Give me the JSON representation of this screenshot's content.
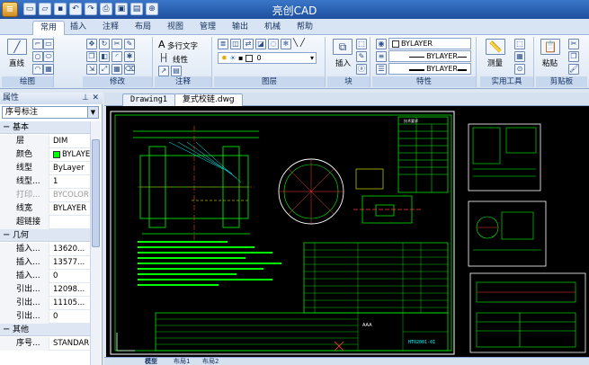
{
  "title_bar": {
    "app_title": "亮创CAD"
  },
  "quick_access": {
    "app_menu_glyph": "≡",
    "buttons": [
      {
        "name": "new-icon",
        "glyph": "▭"
      },
      {
        "name": "open-icon",
        "glyph": "▱"
      },
      {
        "name": "save-icon",
        "glyph": "▪"
      },
      {
        "name": "undo-icon",
        "glyph": "↶"
      },
      {
        "name": "redo-icon",
        "glyph": "↷"
      },
      {
        "name": "print-icon",
        "glyph": "⎙"
      },
      {
        "name": "preview-icon",
        "glyph": "▣"
      },
      {
        "name": "plot-icon",
        "glyph": "▤"
      },
      {
        "name": "zoom-icon",
        "glyph": "⊕"
      }
    ]
  },
  "ribbon": {
    "tabs": [
      "常用",
      "插入",
      "注释",
      "布局",
      "视图",
      "管理",
      "输出",
      "机械",
      "帮助"
    ],
    "active_tab": "常用",
    "panels": {
      "draw": {
        "label": "绘图",
        "line_label": "直线"
      },
      "modify": {
        "label": "修改"
      },
      "annotation": {
        "label": "注释",
        "text_label": "多行文字",
        "dim_label": "线性"
      },
      "layers": {
        "label": "图层",
        "layer_value": "0"
      },
      "block": {
        "label": "块",
        "insert_label": "插入"
      },
      "properties": {
        "label": "特性",
        "color_value": "BYLAYER",
        "linetype_value": "BYLAYER",
        "lineweight_value": "BYLAYER"
      },
      "utilities": {
        "label": "实用工具",
        "measure_label": "测量"
      },
      "clipboard": {
        "label": "剪贴板",
        "paste_label": "粘贴"
      }
    }
  },
  "properties_palette": {
    "title": "属性",
    "selection": "序号标注",
    "sections": [
      {
        "title": "基本",
        "rows": [
          {
            "key": "层",
            "value": "DIM"
          },
          {
            "key": "颜色",
            "value": "BYLAYER",
            "color": "#00ff00"
          },
          {
            "key": "线型",
            "value": "ByLayer"
          },
          {
            "key": "线型...",
            "value": "1"
          },
          {
            "key": "打印...",
            "value": "BYCOLOR",
            "dim": true
          },
          {
            "key": "线宽",
            "value": "BYLAYER"
          },
          {
            "key": "超链接",
            "value": ""
          }
        ]
      },
      {
        "title": "几何",
        "rows": [
          {
            "key": "插入...",
            "value": "13620..."
          },
          {
            "key": "插入...",
            "value": "13577..."
          },
          {
            "key": "插入...",
            "value": "0"
          },
          {
            "key": "引出...",
            "value": "12098..."
          },
          {
            "key": "引出...",
            "value": "11105..."
          },
          {
            "key": "引出...",
            "value": "0"
          }
        ]
      },
      {
        "title": "其他",
        "rows": [
          {
            "key": "序号...",
            "value": "STANDARD"
          }
        ]
      }
    ]
  },
  "document_tabs": [
    {
      "label": "Drawing1",
      "active": false
    },
    {
      "label": "复式校链.dwg",
      "active": true
    }
  ],
  "layout_tabs": [
    "模型",
    "布局1",
    "布局2"
  ],
  "drawing": {
    "sheet_title": "技术要求",
    "drawing_code": "HT02001-01",
    "company_stamp": "AAA",
    "line_color": "#00ff00",
    "frame_color": "#ffffff",
    "accent_colors": [
      "#ff3b3b",
      "#ffff00",
      "#00ffff"
    ]
  },
  "colors": {
    "title_bar": "#2a62b4",
    "ribbon_bg": "#dbe6f4",
    "canvas_bg": "#000000"
  }
}
